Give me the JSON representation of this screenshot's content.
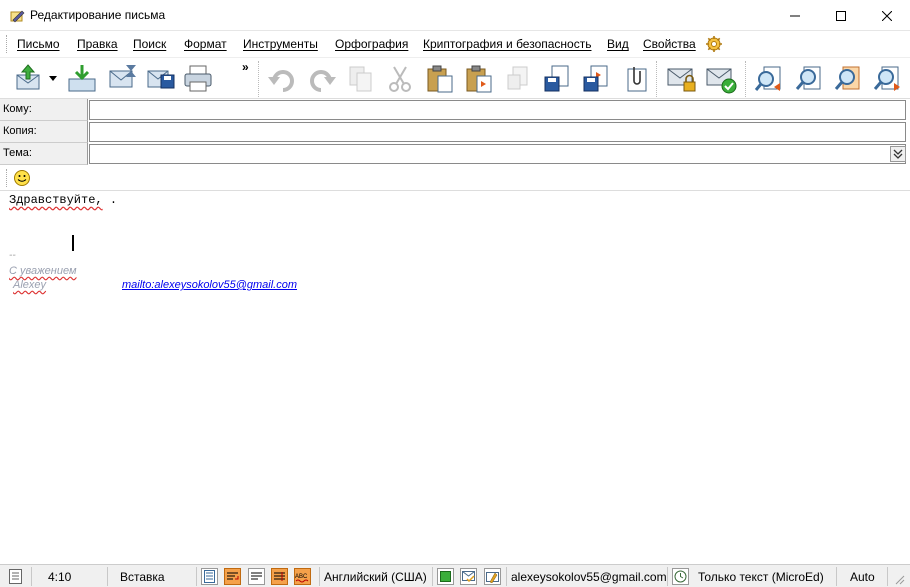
{
  "window": {
    "title": "Редактирование письма",
    "buttons": [
      "minimize",
      "maximize",
      "close"
    ]
  },
  "menu": [
    {
      "label": "Письмо"
    },
    {
      "label": "Правка"
    },
    {
      "label": "Поиск"
    },
    {
      "label": "Формат"
    },
    {
      "label": "Инструменты"
    },
    {
      "label": "Орфография"
    },
    {
      "label": "Криптография и безопасность"
    },
    {
      "label": "Вид"
    },
    {
      "label": "Свойства"
    }
  ],
  "toolbar": {
    "more": "»",
    "icons": [
      "send-icon",
      "queue-icon",
      "save-draft-icon",
      "save-icon",
      "print-icon",
      "undo-icon",
      "redo-icon",
      "copy-icon",
      "cut-icon",
      "paste-icon",
      "paste-quote-icon",
      "new-doc-icon",
      "save-file-icon",
      "insert-file-icon",
      "attach-icon",
      "encrypt-icon",
      "sign-icon",
      "find-prev-icon",
      "find-icon",
      "find-replace-icon",
      "find-next-icon"
    ]
  },
  "fields": {
    "to_label": "Кому:",
    "to_value": "",
    "cc_label": "Копия:",
    "cc_value": "",
    "subject_label": "Тема:",
    "subject_value": ""
  },
  "body": {
    "greeting": "Здравствуйте,",
    "greeting_rest": " .",
    "sig_dash": "--",
    "sig_regards": "С уважением",
    "sig_name": "Alexey",
    "sig_mail": "mailto:alexeysokolov55@gmail.com"
  },
  "status": {
    "position": "4:10",
    "mode": "Вставка",
    "language": "Английский (США)",
    "account": "alexeysokolov55@gmail.com",
    "format": "Только текст (MicroEd)",
    "encoding": "Auto"
  },
  "colors": {
    "accent_orange": "#f5a14a",
    "link": "#0000ee",
    "chrome_bg": "#f0f0f0"
  }
}
